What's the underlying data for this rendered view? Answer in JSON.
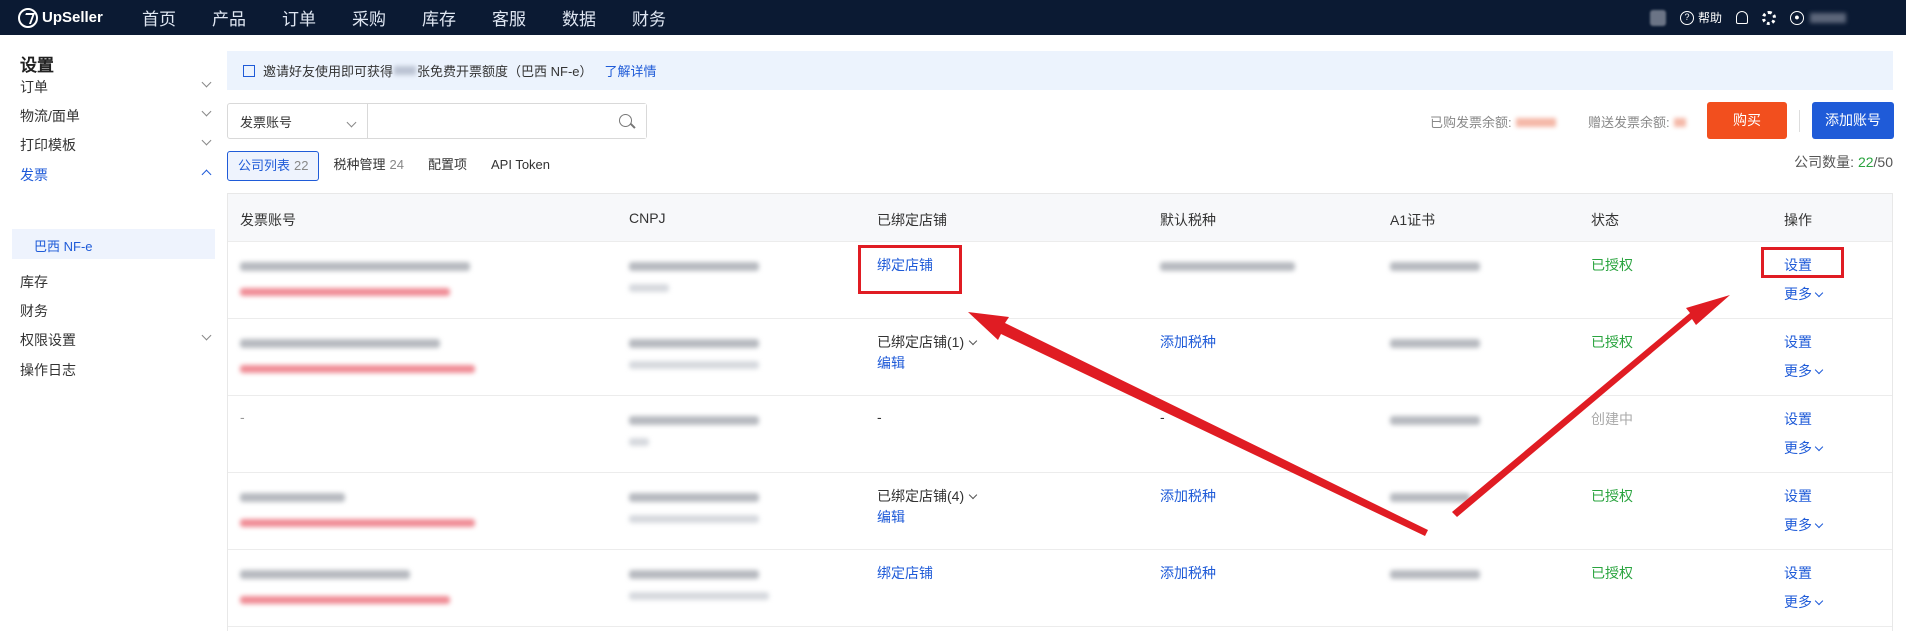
{
  "app": {
    "logo": "UpSeller"
  },
  "nav": [
    "首页",
    "产品",
    "订单",
    "采购",
    "库存",
    "客服",
    "数据",
    "财务"
  ],
  "top_right": {
    "help": "帮助"
  },
  "sidebar": {
    "title": "设置",
    "items": [
      {
        "label": "订单",
        "expand": true
      },
      {
        "label": "物流/面单",
        "expand": true
      },
      {
        "label": "打印模板",
        "expand": true
      },
      {
        "label": "发票",
        "expand": true,
        "active": true
      },
      {
        "label": "库存"
      },
      {
        "label": "财务"
      },
      {
        "label": "权限设置",
        "expand": true
      },
      {
        "label": "操作日志"
      }
    ],
    "sub_item": "巴西 NF-e"
  },
  "banner": {
    "text_before": "邀请好友使用即可获得",
    "text_after": "张免费开票额度（巴西 NF-e）",
    "link": "了解详情"
  },
  "search": {
    "select": "发票账号",
    "placeholder": ""
  },
  "quota": {
    "purchased": "已购发票余额:",
    "gifted": "赠送发票余额:"
  },
  "buttons": {
    "buy": "购买",
    "add_account": "添加账号"
  },
  "tabs": [
    {
      "label": "公司列表",
      "count": "22"
    },
    {
      "label": "税种管理",
      "count": "24"
    },
    {
      "label": "配置项",
      "count": ""
    },
    {
      "label": "API Token",
      "count": ""
    }
  ],
  "company_count": {
    "label": "公司数量:",
    "used": "22",
    "total": "/50"
  },
  "table": {
    "headers": [
      "发票账号",
      "CNPJ",
      "已绑定店铺",
      "默认税种",
      "A1证书",
      "状态",
      "操作"
    ],
    "rows": [
      {
        "account": "",
        "store": "绑定店铺",
        "store_type": "link",
        "store_edit": "",
        "tax": "",
        "tax_type": "blur",
        "status": "已授权",
        "status_color": "#2aa43f",
        "op": "设置",
        "more": "更多"
      },
      {
        "account": "",
        "store": "已绑定店铺(1)",
        "store_type": "bound",
        "store_edit": "编辑",
        "tax": "添加税种",
        "tax_type": "link",
        "status": "已授权",
        "status_color": "#2aa43f",
        "op": "设置",
        "more": "更多"
      },
      {
        "account": "-",
        "store": "-",
        "store_type": "plain",
        "store_edit": "",
        "tax": "-",
        "tax_type": "plain",
        "status": "创建中",
        "status_color": "#aaaaaa",
        "op": "设置",
        "more": "更多"
      },
      {
        "account": "",
        "store": "已绑定店铺(4)",
        "store_type": "bound",
        "store_edit": "编辑",
        "tax": "添加税种",
        "tax_type": "link",
        "status": "已授权",
        "status_color": "#2aa43f",
        "op": "设置",
        "more": "更多"
      },
      {
        "account": "",
        "store": "绑定店铺",
        "store_type": "link",
        "store_edit": "",
        "tax": "添加税种",
        "tax_type": "link",
        "status": "已授权",
        "status_color": "#2aa43f",
        "op": "设置",
        "more": "更多"
      }
    ]
  },
  "colors": {
    "topbar": "#0b1a33",
    "primary": "#1f5bd8",
    "buy": "#f24f1e",
    "annotation": "#e01c23"
  }
}
